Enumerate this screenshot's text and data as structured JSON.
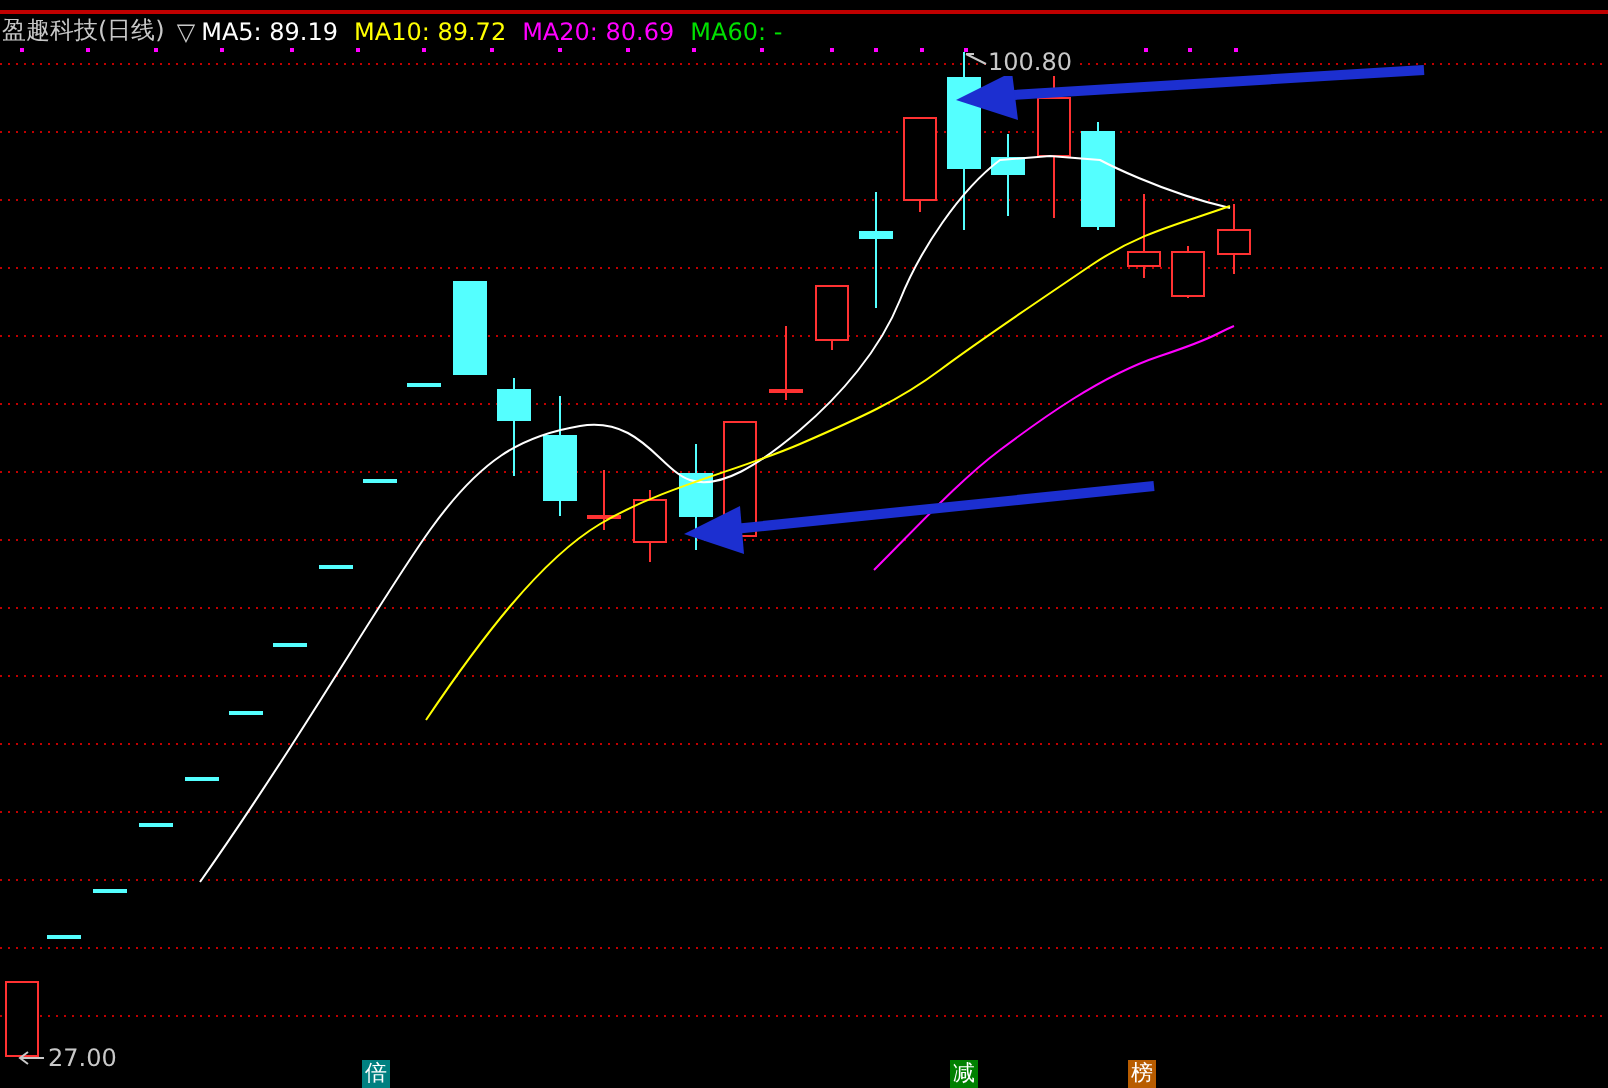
{
  "header": {
    "stock": "盈趣科技(日线)",
    "menu_glyph": "▽",
    "indicators": [
      {
        "label": "MA5: 89.19",
        "color": "#ffffff"
      },
      {
        "label": "MA10: 89.72",
        "color": "#ffff00"
      },
      {
        "label": "MA20: 80.69",
        "color": "#ff00ff"
      },
      {
        "label": "MA60: -",
        "color": "#00e000"
      }
    ]
  },
  "price_labels": {
    "high": "100.80",
    "low": "27.00"
  },
  "signal_tags": [
    {
      "text": "倍",
      "color": "#008080"
    },
    {
      "text": "减",
      "color": "#008000"
    },
    {
      "text": "榜",
      "color": "#b85c00"
    }
  ]
}
